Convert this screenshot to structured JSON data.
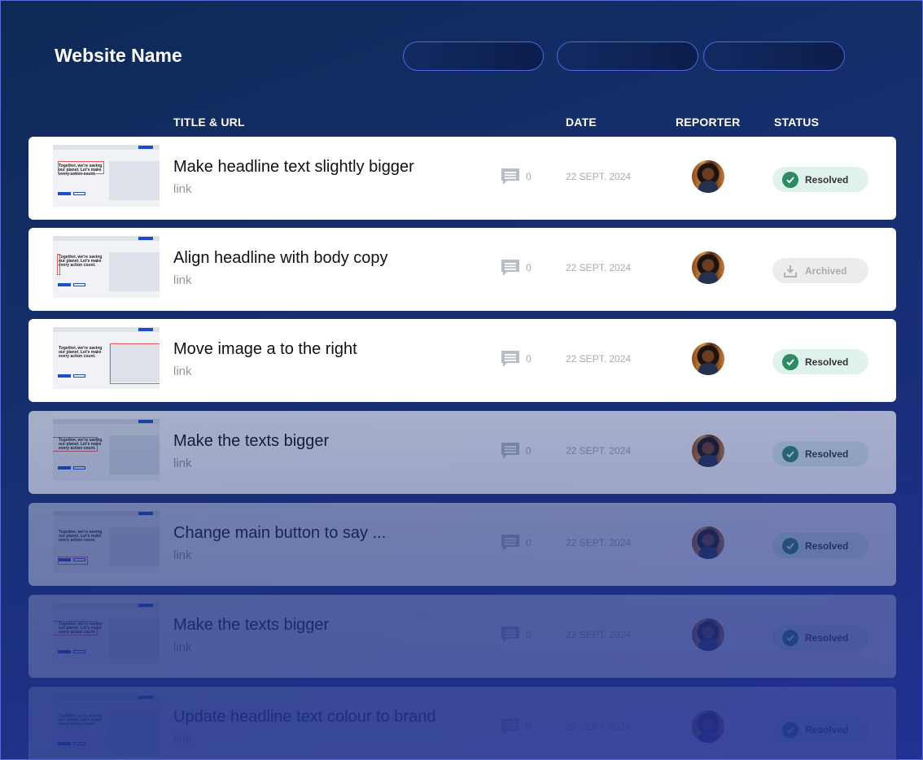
{
  "header": {
    "site_name": "Website Name"
  },
  "columns": {
    "title_url": "TITLE & URL",
    "date": "DATE",
    "reporter": "REPORTER",
    "status": "STATUS"
  },
  "rows": [
    {
      "title": "Make headline text slightly bigger",
      "link": "link",
      "comments": "0",
      "date": "22 SEPT. 2024",
      "status": "Resolved",
      "thumb_text": "Together, we're saving our planet. Let's make every action count."
    },
    {
      "title": "Align headline with body copy",
      "link": "link",
      "comments": "0",
      "date": "22 SEPT. 2024",
      "status": "Archived",
      "thumb_text": "Together, we're saving our planet. Let's make every action count."
    },
    {
      "title": "Move image a to the right",
      "link": "link",
      "comments": "0",
      "date": "22 SEPT. 2024",
      "status": "Resolved",
      "thumb_text": "Together, we're saving our planet. Let's make every action count."
    },
    {
      "title": "Make the texts bigger",
      "link": "link",
      "comments": "0",
      "date": "22 SEPT. 2024",
      "status": "Resolved",
      "thumb_text": "Together, we're saving our planet. Let's make every action count."
    },
    {
      "title": "Change main button to say ...",
      "link": "link",
      "comments": "0",
      "date": "22 SEPT. 2024",
      "status": "Resolved",
      "thumb_text": "Together, we're saving our planet. Let's make every action count."
    },
    {
      "title": "Make the texts bigger",
      "link": "link",
      "comments": "0",
      "date": "22 SEPT. 2024",
      "status": "Resolved",
      "thumb_text": "Together, we're saving our planet. Let's make every action count."
    },
    {
      "title": "Update headline text colour to brand",
      "link": "link",
      "comments": "0",
      "date": "22 SEPT. 2024",
      "status": "Resolved",
      "thumb_text": "Together, we're saving our planet. Let's make every action count."
    }
  ],
  "icons": {
    "comment": "comment-icon",
    "resolved": "check-circle-icon",
    "archived": "archive-download-icon"
  },
  "colors": {
    "accent": "#1d4dc9",
    "resolved_bg": "#dff3ec",
    "resolved_icon": "#2e8a60",
    "archived_bg": "#ececec"
  }
}
